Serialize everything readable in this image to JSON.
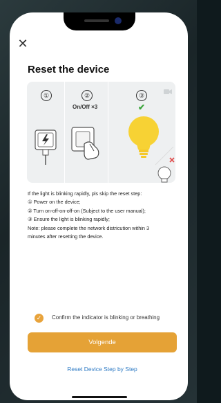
{
  "header": {
    "title": "Reset the device"
  },
  "illustration": {
    "steps": [
      {
        "number": "①",
        "label": ""
      },
      {
        "number": "②",
        "label": "On/Off ×3"
      },
      {
        "number": "③",
        "label": ""
      }
    ]
  },
  "instructions": {
    "lines": [
      "If the light is blinking rapidly, pls skip the reset step:",
      "① Power on the device;",
      "② Turn on-off-on-off-on (Subject to the user manual);",
      "③ Ensure the light is blinking rapidly;",
      "Note: please complete the network districution within 3",
      "minutes after resetting the device."
    ]
  },
  "confirm": {
    "label": "Confirm the indicator is blinking or breathing",
    "checked": true,
    "color": "#e8a33b"
  },
  "actions": {
    "primary_label": "Volgende",
    "secondary_link": "Reset Device Step by Step",
    "primary_color": "#e5a236",
    "link_color": "#2d7ac4"
  },
  "icons": {
    "close": "close-icon",
    "video": "video-icon",
    "check": "checkmark-icon",
    "wrong": "cross-icon"
  }
}
